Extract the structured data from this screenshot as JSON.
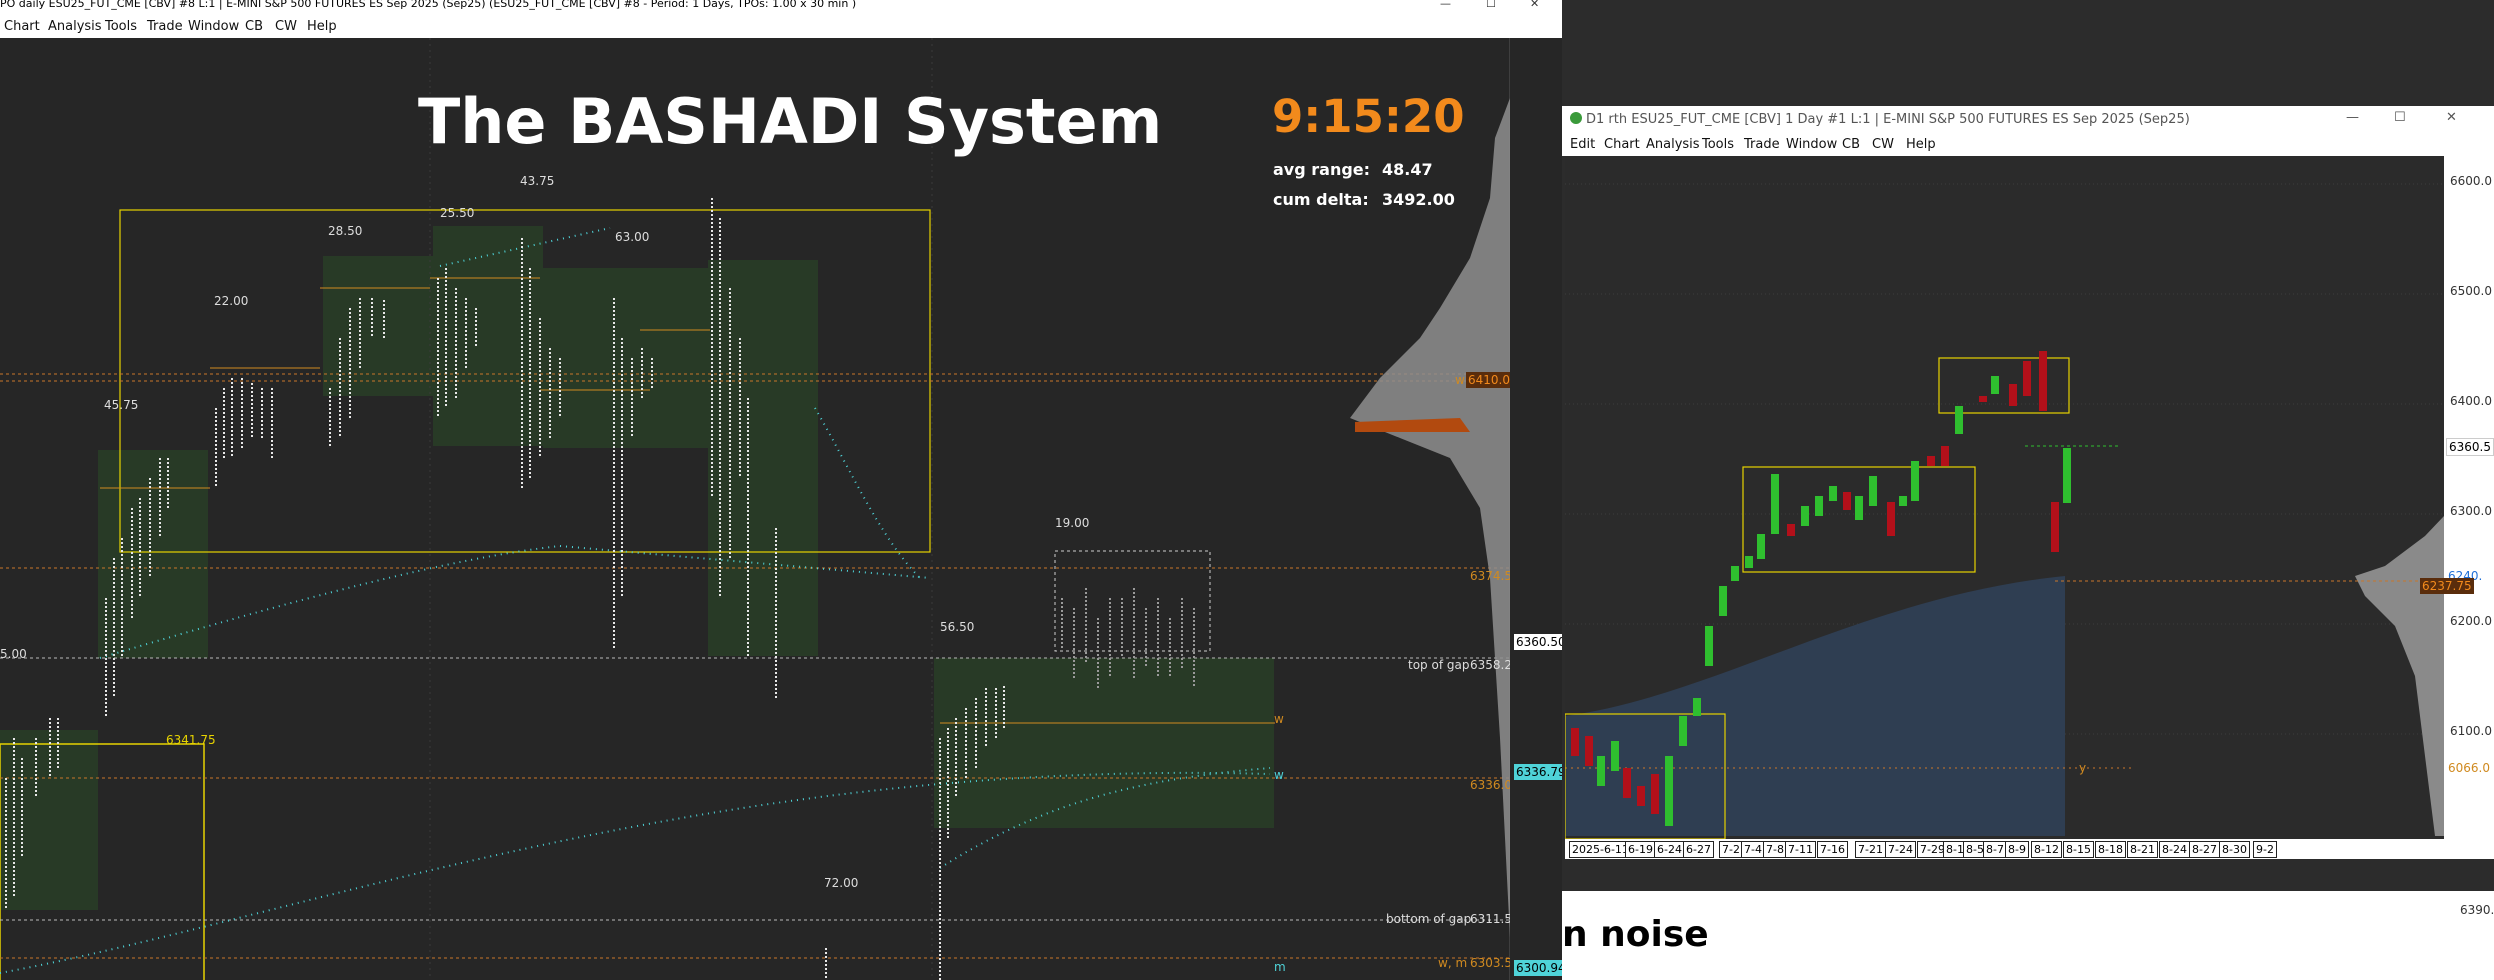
{
  "left_window": {
    "title": "PO daily ESU25_FUT_CME [CBV] #8 L:1 | E-MINI S&P 500 FUTURES ES Sep 2025 (Sep25) (ESU25_FUT_CME [CBV] #8 - Period: 1 Days, TPOs: 1.00 x 30 min )",
    "menu": [
      "Chart",
      "Analysis",
      "Tools",
      "Trade",
      "Window",
      "CB",
      "CW",
      "Help"
    ],
    "controls": {
      "minimize": "—",
      "maximize": "☐",
      "close": "✕"
    }
  },
  "overlay": {
    "system_title": "The BASHADI System",
    "clock": "9:15:20",
    "avg_range_label": "avg range:",
    "avg_range_value": "48.47",
    "cum_delta_label": "cum delta:",
    "cum_delta_value": "3492.00"
  },
  "left_labels": {
    "range_labels": [
      "43.75",
      "25.50",
      "28.50",
      "63.00",
      "22.00",
      "45.75",
      "19.00",
      "56.50",
      "72.00",
      "5.00"
    ],
    "level_6341": "6341.75",
    "w_6410": "w",
    "price_6410": "6410.00",
    "price_6374": "6374.50",
    "price_6360": "6360.50",
    "top_of_gap": "top of gap",
    "price_6358": "6358.25",
    "w_mark_1": "w",
    "w_mark_2": "w",
    "price_6336_79": "6336.79",
    "price_6336": "6336.00",
    "bottom_of_gap": "bottom of gap",
    "price_6311": "6311.50",
    "wm_label": "w, m",
    "price_6303": "6303.50",
    "price_6300": "6300.94",
    "m_mark": "m"
  },
  "right_window": {
    "title": "D1 rth ESU25_FUT_CME [CBV]  1 Day  #1 L:1 | E-MINI S&P 500 FUTURES ES Sep 2025 (Sep25)",
    "menu": [
      "Edit",
      "Chart",
      "Analysis",
      "Tools",
      "Trade",
      "Window",
      "CB",
      "CW",
      "Help"
    ],
    "controls": {
      "minimize": "—",
      "maximize": "☐",
      "close": "✕"
    },
    "price_ticks": [
      "6600.0",
      "6500.0",
      "6400.0",
      "6300.0",
      "6200.0",
      "6100.0"
    ],
    "price_tags": {
      "p6360": "6360.5",
      "p6240": "6240.",
      "p6237": "6237.75",
      "p6066": "6066.0"
    },
    "y_mark": "y",
    "dates": [
      "2025-6-11",
      "6-19",
      "6-24",
      "6-27",
      "7-2",
      "7-4",
      "7-8",
      "7-11",
      "7-16",
      "7-21",
      "7-24",
      "7-29",
      "8-1",
      "8-5",
      "8-7",
      "8-9",
      "8-12",
      "8-15",
      "8-18",
      "8-21",
      "8-24",
      "8-27",
      "8-30",
      "9-2"
    ],
    "bottom_tick": "6390."
  },
  "caption": {
    "text": "n noise"
  },
  "colors": {
    "accent_orange": "#f28a1c",
    "box_yellow": "#e6d200",
    "bull": "#2fbf2f",
    "bear": "#b3101a",
    "vah_cyan": "#4fd3d8"
  }
}
